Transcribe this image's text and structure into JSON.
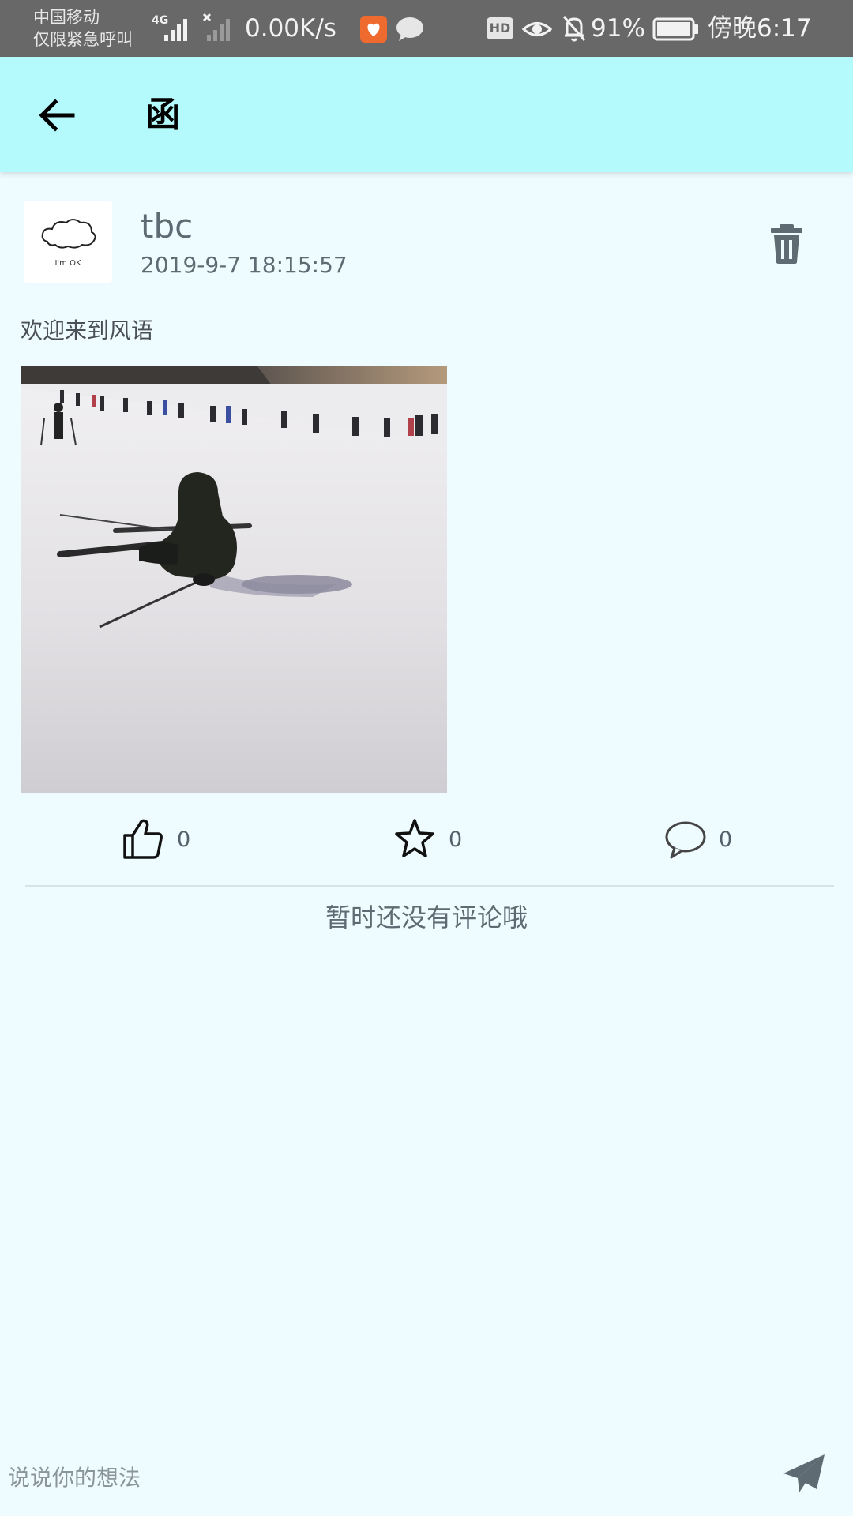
{
  "status_bar": {
    "carrier_line1": "中国移动",
    "carrier_line2": "仅限紧急呼叫",
    "network_type": "4G",
    "net_speed": "0.00K/s",
    "hd_label": "HD",
    "battery_percent": "91%",
    "time": "傍晚6:17"
  },
  "toolbar": {
    "title": "函",
    "back_icon": "arrow-left-icon"
  },
  "post": {
    "avatar_text": "I'm OK",
    "user_name": "tbc",
    "timestamp": "2019-9-7 18:15:57",
    "text": "欢迎来到风语",
    "image_subject": "skier-sitting-on-snow-slope",
    "delete_icon": "trash-icon"
  },
  "actions": {
    "like_count": "0",
    "favorite_count": "0",
    "comment_count": "0"
  },
  "comments": {
    "empty_text": "暂时还没有评论哦"
  },
  "composer": {
    "placeholder": "说说你的想法",
    "value": "",
    "send_icon": "send-icon"
  },
  "colors": {
    "toolbar_bg": "#b4fafc",
    "page_bg": "#eefbff",
    "status_bar_bg": "#686868",
    "muted_text": "#5f6b73"
  }
}
